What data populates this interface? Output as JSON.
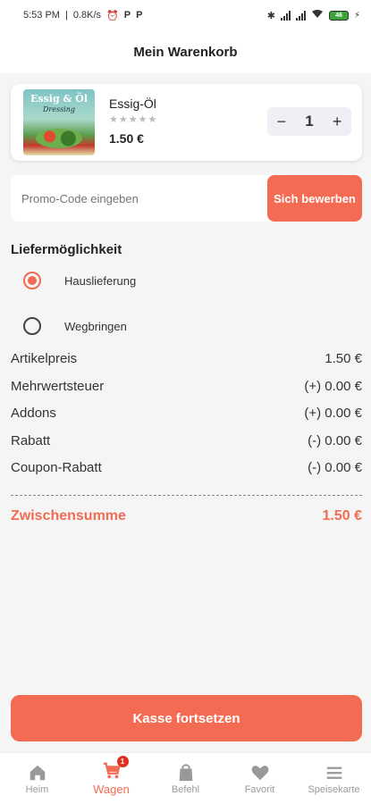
{
  "status_bar": {
    "time": "5:53 PM",
    "speed": "0.8K/s",
    "battery": "46"
  },
  "header": {
    "title": "Mein Warenkorb"
  },
  "cart": {
    "items": [
      {
        "image_title": "Essig & Öl",
        "image_subtitle": "Dressing",
        "name": "Essig-Öl",
        "stars": "★★★★★",
        "price": "1.50 €",
        "quantity": "1",
        "minus": "−",
        "plus": "+"
      }
    ]
  },
  "promo": {
    "placeholder": "Promo-Code eingeben",
    "button_label": "Sich bewerben"
  },
  "delivery": {
    "title": "Liefermöglichkeit",
    "options": [
      {
        "label": "Hauslieferung",
        "selected": true
      },
      {
        "label": "Wegbringen",
        "selected": false
      }
    ]
  },
  "summary": {
    "rows": [
      {
        "label": "Artikelpreis",
        "value": "1.50 €"
      },
      {
        "label": "Mehrwertsteuer",
        "value": "(+) 0.00 €"
      },
      {
        "label": "Addons",
        "value": "(+) 0.00 €"
      },
      {
        "label": "Rabatt",
        "value": "(-) 0.00 €"
      },
      {
        "label": "Coupon-Rabatt",
        "value": "(-) 0.00 €"
      }
    ],
    "subtotal_label": "Zwischensumme",
    "subtotal_value": "1.50 €"
  },
  "checkout": {
    "label": "Kasse fortsetzen"
  },
  "nav": {
    "items": [
      {
        "label": "Heim",
        "icon": "home-icon"
      },
      {
        "label": "Wagen",
        "icon": "cart-icon",
        "badge": "1",
        "active": true
      },
      {
        "label": "Befehl",
        "icon": "bag-icon"
      },
      {
        "label": "Favorit",
        "icon": "heart-icon"
      },
      {
        "label": "Speisekarte",
        "icon": "menu-icon"
      }
    ]
  },
  "colors": {
    "accent": "#f36b52",
    "badge": "#e0301e"
  }
}
